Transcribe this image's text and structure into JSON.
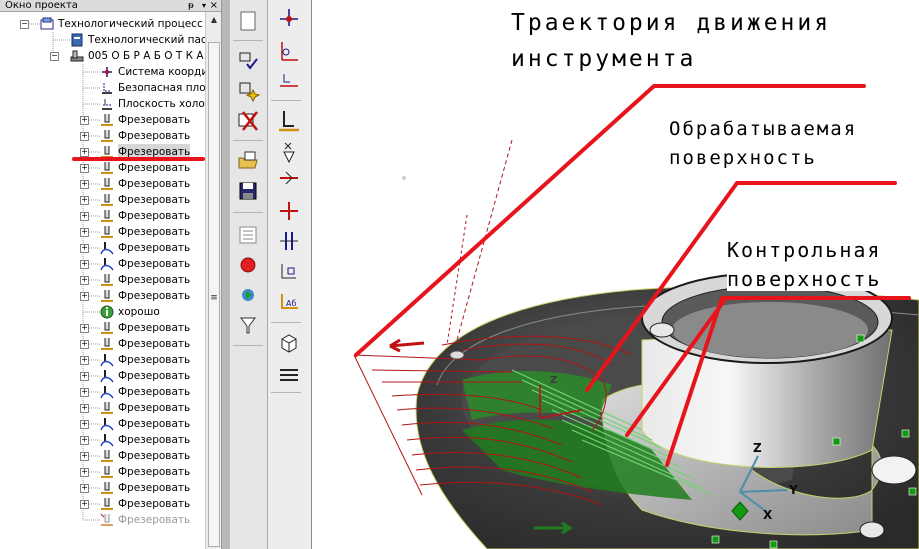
{
  "project_panel": {
    "title": "Окно проекта",
    "pin_glyph": "ᵽ",
    "close_glyph": "×",
    "items": [
      {
        "label": "Технологический процесс",
        "level": 0,
        "icon": "process-icon",
        "expander": "-"
      },
      {
        "label": "Технологический паспорт",
        "level": 1,
        "icon": "passport-icon",
        "expander": ""
      },
      {
        "label": "005 О Б Р А Б О Т К А",
        "level": 1,
        "icon": "machine-icon",
        "expander": "-"
      },
      {
        "label": "Система координат",
        "level": 2,
        "icon": "coordsys-icon",
        "expander": ""
      },
      {
        "label": "Безопасная плоскость",
        "level": 2,
        "icon": "safe-plane-icon",
        "expander": ""
      },
      {
        "label": "Плоскость холостых",
        "level": 2,
        "icon": "idle-plane-icon",
        "expander": ""
      },
      {
        "label": "Фрезеровать",
        "level": 2,
        "icon": "mill-icon",
        "expander": "+"
      },
      {
        "label": "Фрезеровать",
        "level": 2,
        "icon": "mill-icon",
        "expander": "+"
      },
      {
        "label": "Фрезеровать",
        "level": 2,
        "icon": "mill-icon",
        "expander": "+",
        "selected": true
      },
      {
        "label": "Фрезеровать",
        "level": 2,
        "icon": "mill-icon",
        "expander": "+"
      },
      {
        "label": "Фрезеровать",
        "level": 2,
        "icon": "mill-icon",
        "expander": "+"
      },
      {
        "label": "Фрезеровать",
        "level": 2,
        "icon": "mill-icon",
        "expander": "+"
      },
      {
        "label": "Фрезеровать",
        "level": 2,
        "icon": "mill-icon",
        "expander": "+"
      },
      {
        "label": "Фрезеровать",
        "level": 2,
        "icon": "mill-icon",
        "expander": "+"
      },
      {
        "label": "Фрезеровать",
        "level": 2,
        "icon": "mill-surface-icon",
        "expander": "+"
      },
      {
        "label": "Фрезеровать",
        "level": 2,
        "icon": "mill-surface-icon",
        "expander": "+"
      },
      {
        "label": "Фрезеровать",
        "level": 2,
        "icon": "mill-icon",
        "expander": "+"
      },
      {
        "label": "Фрезеровать",
        "level": 2,
        "icon": "mill-icon",
        "expander": "+"
      },
      {
        "label": "хорошо",
        "level": 2,
        "icon": "info-icon",
        "expander": ""
      },
      {
        "label": "Фрезеровать",
        "level": 2,
        "icon": "mill-icon",
        "expander": "+"
      },
      {
        "label": "Фрезеровать",
        "level": 2,
        "icon": "mill-icon",
        "expander": "+"
      },
      {
        "label": "Фрезеровать",
        "level": 2,
        "icon": "mill-surface-icon",
        "expander": "+"
      },
      {
        "label": "Фрезеровать",
        "level": 2,
        "icon": "mill-surface-icon",
        "expander": "+"
      },
      {
        "label": "Фрезеровать",
        "level": 2,
        "icon": "mill-surface-icon",
        "expander": "+"
      },
      {
        "label": "Фрезеровать",
        "level": 2,
        "icon": "mill-icon",
        "expander": "+"
      },
      {
        "label": "Фрезеровать",
        "level": 2,
        "icon": "mill-surface-icon",
        "expander": "+"
      },
      {
        "label": "Фрезеровать",
        "level": 2,
        "icon": "mill-surface-icon",
        "expander": "+"
      },
      {
        "label": "Фрезеровать",
        "level": 2,
        "icon": "mill-icon",
        "expander": "+"
      },
      {
        "label": "Фрезеровать",
        "level": 2,
        "icon": "mill-icon",
        "expander": "+"
      },
      {
        "label": "Фрезеровать",
        "level": 2,
        "icon": "mill-icon",
        "expander": "+"
      },
      {
        "label": "Фрезеровать",
        "level": 2,
        "icon": "mill-icon",
        "expander": "+"
      },
      {
        "label": "Фрезеровать",
        "level": 2,
        "icon": "mill-disabled-icon",
        "expander": "",
        "disabled": true
      }
    ]
  },
  "toolbar_left": {
    "buttons": [
      "new-document-icon",
      "select-check-icon",
      "select-star-icon",
      "delete-cross-icon",
      "open-folder-icon",
      "save-icon",
      "list-view-icon",
      "record-icon",
      "play-icon",
      "filter-icon"
    ]
  },
  "toolbar_right": {
    "buttons": [
      "coordsys-tool-icon",
      "safe-plane-tool-icon",
      "idle-plane-tool-icon",
      "mill-tool-icon",
      "drill-tool-icon",
      "lathe-tool-icon",
      "point-tool-icon",
      "gap-tool-icon",
      "depth-tool-icon",
      "ab-tool-icon",
      "cube-view-icon",
      "layers-tool-icon"
    ]
  },
  "annotations": {
    "tool_path_line1": "Траектория движения",
    "tool_path_line2": "инструмента",
    "machined_line1": "Обрабатываемая",
    "machined_line2": "поверхность",
    "control_line1": "Контрольная",
    "control_line2": "поверхность"
  },
  "axes": {
    "z": "Z",
    "y": "Y",
    "x": "X"
  },
  "colors": {
    "annotation_line": "#e8141c",
    "toolpath": "#b21414",
    "machined_fill": "#1e8c1e",
    "part_dark": "#3c3c3c",
    "part_light": "#c8c8c8",
    "axis": "#4a8fa8",
    "handle": "#139a13"
  }
}
